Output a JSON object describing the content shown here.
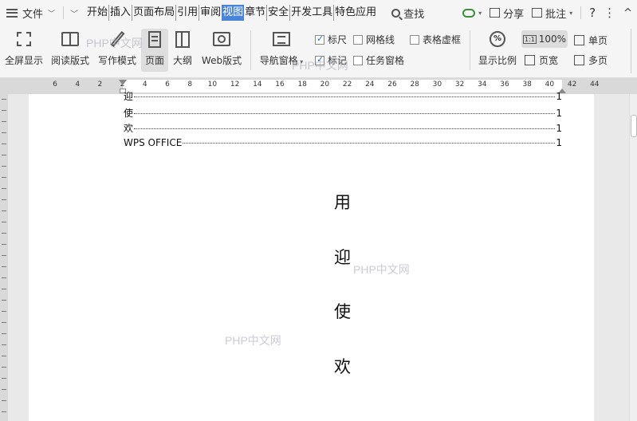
{
  "menubar": {
    "file_label": "文件",
    "tabs": [
      "开始",
      "插入",
      "页面布局",
      "引用",
      "审阅",
      "视图",
      "章节",
      "安全",
      "开发工具",
      "特色应用"
    ],
    "active_tab": "视图",
    "search_label": "查找",
    "share_label": "分享",
    "comment_label": "批注",
    "help_glyph": "?",
    "more_glyph": "⋮",
    "close_glyph": "^"
  },
  "ribbon": {
    "fullscreen": "全屏显示",
    "read_mode": "阅读版式",
    "write_mode": "写作模式",
    "page_view": "页面",
    "outline": "大纲",
    "web_view": "Web版式",
    "nav_pane": "导航窗格",
    "ruler": "标尺",
    "gridlines": "网格线",
    "table_borders": "表格虚框",
    "marks": "标记",
    "task_pane": "任务窗格",
    "zoom_ratio": "显示比例",
    "zoom_value": "100%",
    "page_width": "页宽",
    "single_page": "单页",
    "multi_page": "多页",
    "checkbox_states": {
      "ruler": true,
      "gridlines": false,
      "table_borders": false,
      "marks": true,
      "task_pane": false
    }
  },
  "ruler_numbers": [
    "6",
    "4",
    "2",
    "2",
    "4",
    "6",
    "8",
    "10",
    "12",
    "14",
    "16",
    "18",
    "20",
    "22",
    "24",
    "26",
    "28",
    "30",
    "32",
    "34",
    "36",
    "38",
    "40",
    "42",
    "44"
  ],
  "document": {
    "toc": [
      {
        "text": "迎",
        "page": "1"
      },
      {
        "text": "使",
        "page": "1"
      },
      {
        "text": "欢",
        "page": "1"
      },
      {
        "text": "WPS OFFICE",
        "page": "1"
      }
    ],
    "body_chars": [
      "用",
      "迎",
      "使",
      "欢"
    ]
  },
  "watermarks": [
    "PHP中文网",
    "PHP中文网",
    "PHP中文网",
    "PHP中文网"
  ],
  "colors": {
    "active_tab": "#4a84d8",
    "check": "#2a6cc8",
    "cloud": "#3a8f3a"
  }
}
